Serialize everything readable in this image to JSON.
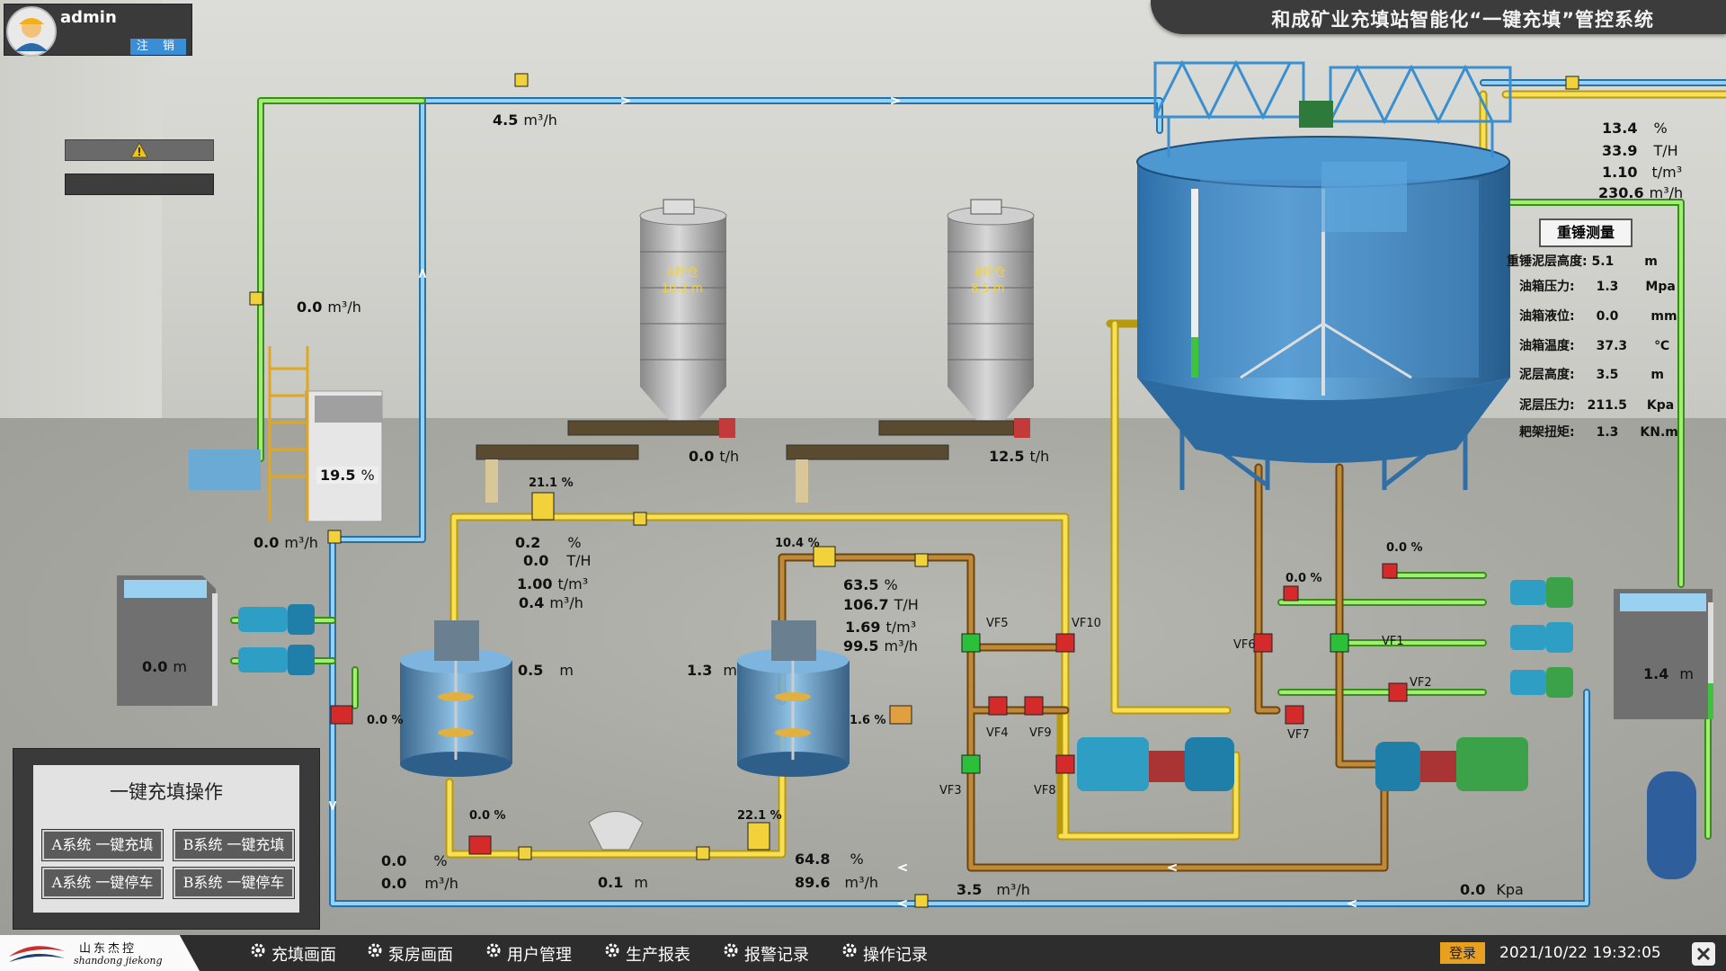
{
  "header": {
    "title": "和成矿业充填站智能化“一键充填”管控系统"
  },
  "user": {
    "name": "admin",
    "logout_label": "注  销"
  },
  "alarm": {
    "icon": "warning-icon"
  },
  "readouts": {
    "top_flow": {
      "value": "4.5",
      "unit": "m³/h"
    },
    "left_flow": {
      "value": "0.0",
      "unit": "m³/h"
    },
    "mixer_pct": {
      "value": "19.5",
      "unit": "%"
    },
    "mixer_flow": {
      "value": "0.0",
      "unit": "m³/h"
    },
    "left_tank_level": {
      "value": "0.0",
      "unit": "m"
    },
    "silo1_feed": {
      "value": "0.0",
      "unit": "t/h"
    },
    "silo2_feed": {
      "value": "12.5",
      "unit": "t/h"
    },
    "line_a_pct": {
      "value": "0.2",
      "unit": "%"
    },
    "line_a_mass": {
      "value": "0.0",
      "unit": "T/H"
    },
    "line_a_density": {
      "value": "1.00",
      "unit": "t/m³"
    },
    "line_a_flow": {
      "value": "0.4",
      "unit": "m³/h"
    },
    "line_b_pct": {
      "value": "63.5",
      "unit": "%"
    },
    "line_b_mass": {
      "value": "106.7",
      "unit": "T/H"
    },
    "line_b_density": {
      "value": "1.69",
      "unit": "t/m³"
    },
    "line_b_flow": {
      "value": "99.5",
      "unit": "m³/h"
    },
    "stirrer_a_level": {
      "value": "0.5",
      "unit": "m"
    },
    "stirrer_b_level": {
      "value": "1.3",
      "unit": "m"
    },
    "bottom_a_pct": {
      "value": "0.0",
      "unit": "%"
    },
    "bottom_a_flow": {
      "value": "0.0",
      "unit": "m³/h"
    },
    "hopper_level": {
      "value": "0.1",
      "unit": "m"
    },
    "bottom_b_pct": {
      "value": "64.8",
      "unit": "%"
    },
    "bottom_b_flow": {
      "value": "89.6",
      "unit": "m³/h"
    },
    "return_flow": {
      "value": "3.5",
      "unit": "m³/h"
    },
    "pressure": {
      "value": "0.0",
      "unit": "Kpa"
    },
    "right_tank_level": {
      "value": "1.4",
      "unit": "m"
    },
    "thickener_pct": {
      "value": "13.4",
      "unit": "%"
    },
    "thickener_mass": {
      "value": "33.9",
      "unit": "T/H"
    },
    "thickener_density": {
      "value": "1.10",
      "unit": "t/m³"
    },
    "thickener_flow": {
      "value": "230.6",
      "unit": "m³/h"
    }
  },
  "valve_tags": {
    "v1": "21.1",
    "v2": "10.4",
    "v3": "0.0",
    "v4": "1.6",
    "v5": "0.0",
    "v6": "22.1",
    "v7": "0.0",
    "v8": "0.0"
  },
  "valve_labels": [
    "VF5",
    "VF10",
    "VF4",
    "VF9",
    "VF3",
    "VF8",
    "VF6",
    "VF1",
    "VF2",
    "VF7"
  ],
  "silos": [
    {
      "name": "A粉仓",
      "level": "10.2",
      "unit": "m"
    },
    {
      "name": "B粉仓",
      "level": "8.5",
      "unit": "m"
    }
  ],
  "measure": {
    "button": "重锤测量",
    "rows": [
      {
        "label": "重锤泥层高度:",
        "value": "5.1",
        "unit": "m"
      },
      {
        "label": "油箱压力:",
        "value": "1.3",
        "unit": "Mpa"
      },
      {
        "label": "油箱液位:",
        "value": "0.0",
        "unit": "mm"
      },
      {
        "label": "油箱温度:",
        "value": "37.3",
        "unit": "℃"
      },
      {
        "label": "泥层高度:",
        "value": "3.5",
        "unit": "m"
      },
      {
        "label": "泥层压力:",
        "value": "211.5",
        "unit": "Kpa"
      },
      {
        "label": "耙架扭矩:",
        "value": "1.3",
        "unit": "KN.m"
      }
    ]
  },
  "ops": {
    "title": "一键充填操作",
    "a_fill": "A系统 一键充填",
    "b_fill": "B系统 一键充填",
    "a_stop": "A系统 一键停车",
    "b_stop": "B系统 一键停车"
  },
  "nav": {
    "items": [
      "充填画面",
      "泵房画面",
      "用户管理",
      "生产报表",
      "报警记录",
      "操作记录"
    ],
    "icon": "gear-icon",
    "login": "登录",
    "datetime": "2021/10/22  19:32:05"
  },
  "logo": {
    "cn": "山东杰控",
    "en": "shandong jiekong"
  },
  "colors": {
    "water_pipe": "#5bb0e8",
    "slurry_pipe": "#f2d23a",
    "green_pipe": "#7ee04a",
    "brown_pipe": "#9a6a2a",
    "tank_blue": "#3d8fd0"
  }
}
